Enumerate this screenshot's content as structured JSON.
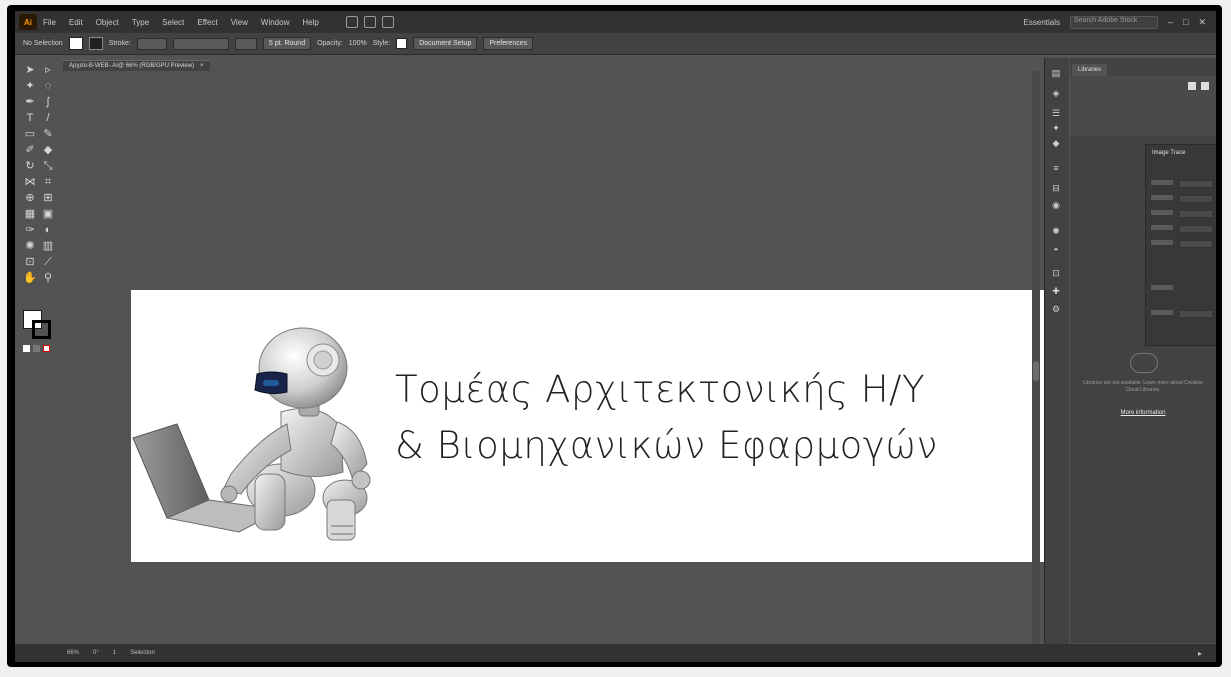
{
  "app": {
    "logo": "Ai",
    "menu": [
      "File",
      "Edit",
      "Object",
      "Type",
      "Select",
      "Effect",
      "View",
      "Window",
      "Help"
    ],
    "workspace": "Essentials",
    "search_placeholder": "Search Adobe Stock",
    "window_controls": [
      "–",
      "□",
      "✕"
    ]
  },
  "control_bar": {
    "selection_label": "No Selection",
    "stroke_label": "Stroke:",
    "brush_label": "5 pt. Round",
    "opacity_label": "Opacity:",
    "opacity_value": "100%",
    "style_label": "Style:",
    "doc_setup_button": "Document Setup",
    "preferences_button": "Preferences",
    "fill_color": "#ffffff",
    "stroke_color": "#000000"
  },
  "document": {
    "tab_title": "Αρχείο-Β-WEB-.AI@ 66% (RGB/GPU Preview)",
    "tab_close": "×"
  },
  "artboard": {
    "line1": "Τομέας Αρχιτεκτονικής Η/Υ",
    "line2": "& Βιομηχανικών Εφαρμογών",
    "text_color": "#222222",
    "background": "#ffffff"
  },
  "panels": {
    "properties_tab": "Libraries",
    "image_trace_title": "Image Trace",
    "info_text": "Libraries are not available. Learn more about Creative Cloud Libraries.",
    "info_link": "More information"
  },
  "status_bar": {
    "zoom": "66%",
    "rotation": "0°",
    "page": "1",
    "tool": "Selection"
  },
  "colors": {
    "app_bg": "#535353",
    "menu_bg": "#323232",
    "panel_bg": "#424242"
  }
}
